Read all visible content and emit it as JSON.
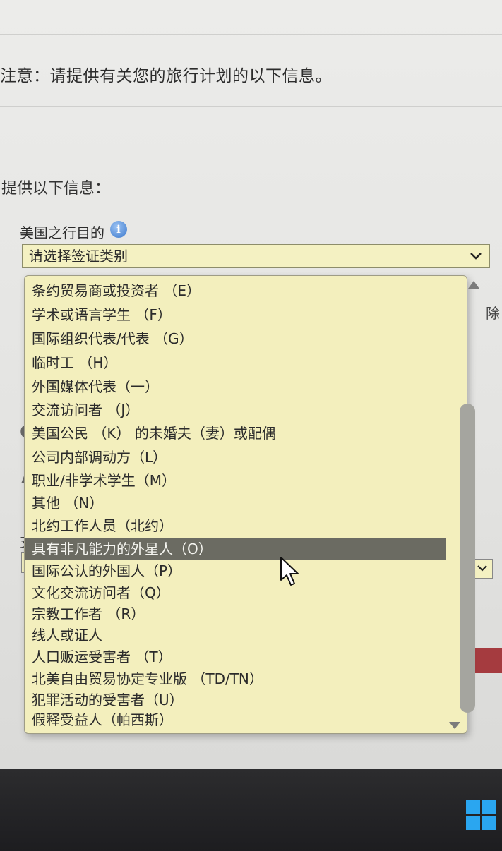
{
  "notice": "注意：请提供有关您的旅行计划的以下信息。",
  "provide_label": "提供以下信息：",
  "purpose": {
    "label": "美国之行目的",
    "selected": "请选择签证类别"
  },
  "dropdown": {
    "highlighted_index": 11,
    "options": [
      "条约贸易商或投资者 （E）",
      "学术或语言学生 （F）",
      "国际组织代表/代表 （G）",
      "临时工 （H）",
      "外国媒体代表（一）",
      "交流访问者 （J）",
      "美国公民 （K） 的未婚夫（妻）或配偶",
      "公司内部调动方（L）",
      "职业/非学术学生（M）",
      "其他 （N）",
      "北约工作人员（北约）",
      "具有非凡能力的外星人（O）",
      "国际公认的外国人（P）",
      "文化交流访问者（Q）",
      "宗教工作者 （R）",
      "线人或证人",
      "人口贩运受害者 （T）",
      "北美自由贸易协定专业版 （TD/TN）",
      "犯罪活动的受害者（U）",
      "假释受益人（帕西斯）"
    ]
  },
  "fragments": {
    "right_top": "除",
    "left_c": "C",
    "left_a": "A",
    "left_zhi": "支"
  },
  "colors": {
    "select_bg": "#f4f1c2",
    "highlight": "#6b6b62",
    "accent_red": "#a53b3f",
    "taskbar": "#1d1d20",
    "windows_blue": "#2aa6f0"
  },
  "icons": {
    "info": "i"
  }
}
